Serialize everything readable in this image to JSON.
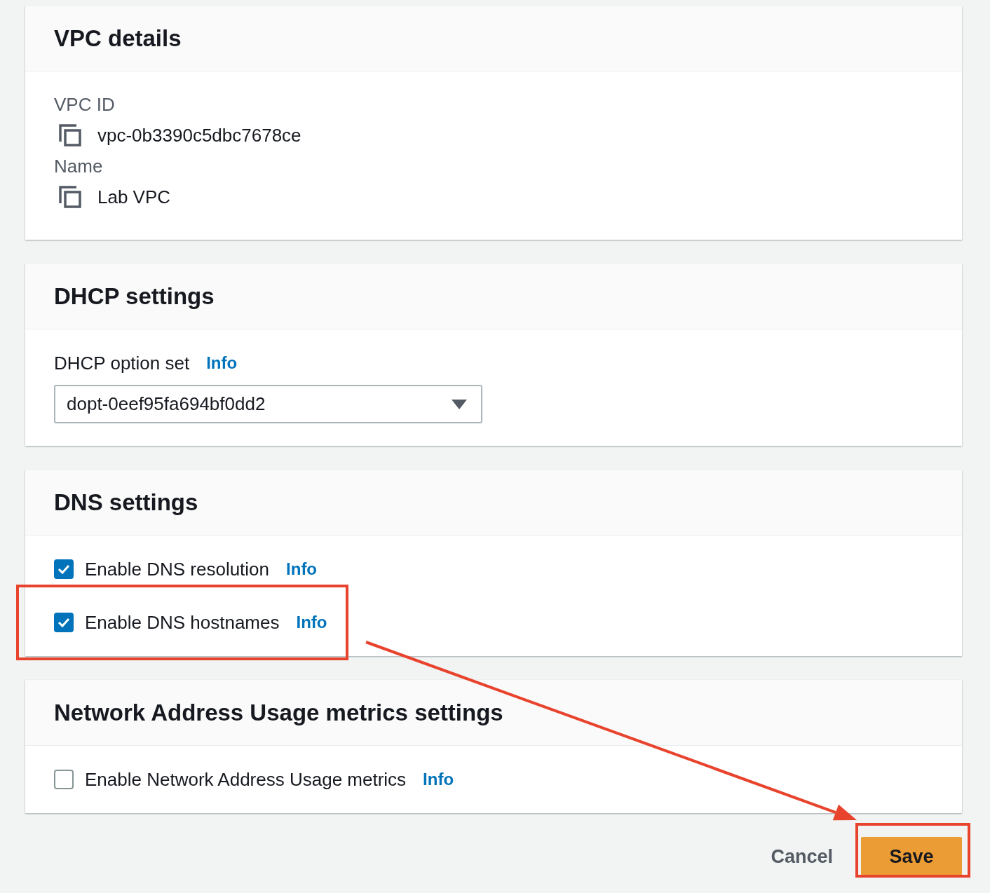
{
  "sections": [
    {
      "kind": "details",
      "title": "VPC details",
      "fields": [
        {
          "label": "VPC ID",
          "value": "vpc-0b3390c5dbc7678ce"
        },
        {
          "label": "Name",
          "value": "Lab VPC"
        }
      ]
    },
    {
      "kind": "select",
      "title": "DHCP settings",
      "label": "DHCP option set",
      "info": "Info",
      "value": "dopt-0eef95fa694bf0dd2"
    },
    {
      "kind": "checkboxes",
      "title": "DNS settings",
      "options": [
        {
          "label": "Enable DNS resolution",
          "info": "Info",
          "checked": true,
          "highlighted": false
        },
        {
          "label": "Enable DNS hostnames",
          "info": "Info",
          "checked": true,
          "highlighted": true
        }
      ]
    },
    {
      "kind": "checkboxes",
      "title": "Network Address Usage metrics settings",
      "options": [
        {
          "label": "Enable Network Address Usage metrics",
          "info": "Info",
          "checked": false,
          "highlighted": false
        }
      ]
    }
  ],
  "actions": [
    {
      "kind": "link",
      "label": "Cancel",
      "highlighted": false
    },
    {
      "kind": "primary",
      "label": "Save",
      "highlighted": true
    }
  ]
}
